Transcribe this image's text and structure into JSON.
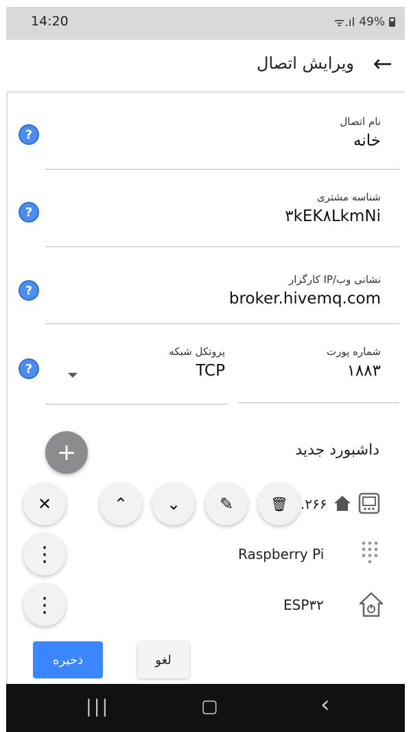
{
  "status_bar": {
    "time": "14:20",
    "signal": "ᯤ.ıl",
    "battery": "49%"
  },
  "app_bar": {
    "title": "ویرایش اتصال"
  },
  "fields": {
    "connection_name": {
      "label": "نام اتصال",
      "value": "خانه"
    },
    "client_id": {
      "label": "شناسه مشتری",
      "value": "۳kEK۸LkmNi"
    },
    "broker_address": {
      "label": "نشانی وب/IP کارگزار",
      "value": "broker.hivemq.com"
    },
    "port": {
      "label": "شماره پورت",
      "value": "۱۸۸۳"
    },
    "protocol": {
      "label": "پروتکل شبکه",
      "value": "TCP"
    }
  },
  "help_icon": "?",
  "dashboard": {
    "heading": "داشبورد جدید",
    "add_label": "+",
    "rows": [
      {
        "label": ".۲۶۶",
        "icon": "home-icon"
      },
      {
        "label": "Raspberry Pi",
        "icon": "grid-dots-icon"
      },
      {
        "label": "ESP۳۲",
        "icon": "home-power-icon"
      }
    ]
  },
  "row_actions": {
    "close": "✕",
    "up": "⌃",
    "down": "⌄",
    "edit": "✎",
    "delete": "🗑",
    "more": "⋮"
  },
  "buttons": {
    "save": "ذخیره",
    "cancel": "لغو"
  },
  "nav_bar": {
    "recents": "|||",
    "home": "▢",
    "back": "‹"
  }
}
